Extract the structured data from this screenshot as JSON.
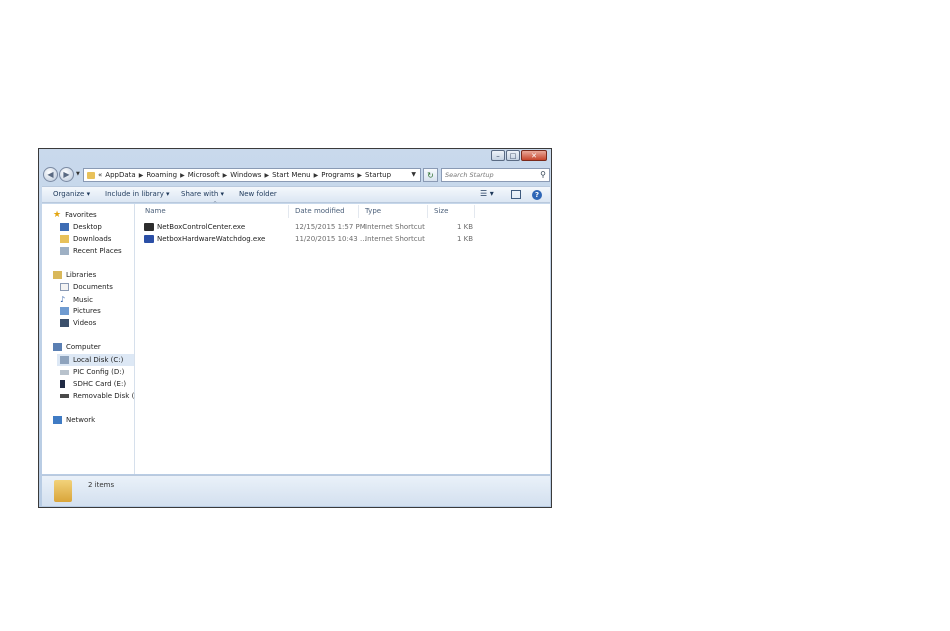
{
  "window": {
    "controls": {
      "minimize": "–",
      "maximize": "□",
      "close": "✕"
    }
  },
  "navigation": {
    "back_icon": "back-arrow-icon",
    "forward_icon": "forward-arrow-icon",
    "breadcrumb": [
      "«",
      "AppData",
      "Roaming",
      "Microsoft",
      "Windows",
      "Start Menu",
      "Programs",
      "Startup"
    ],
    "search_placeholder": "Search Startup"
  },
  "toolbar": {
    "organize": "Organize ▾",
    "include_in_library": "Include in library ▾",
    "share_with": "Share with ▾",
    "new_folder": "New folder"
  },
  "sidebar": {
    "favorites": {
      "label": "Favorites",
      "items": [
        "Desktop",
        "Downloads",
        "Recent Places"
      ]
    },
    "libraries": {
      "label": "Libraries",
      "items": [
        "Documents",
        "Music",
        "Pictures",
        "Videos"
      ]
    },
    "computer": {
      "label": "Computer",
      "items": [
        "Local Disk (C:)",
        "PIC Config (D:)",
        "SDHC Card (E:)",
        "Removable Disk (F:)"
      ]
    },
    "network": {
      "label": "Network"
    }
  },
  "file_list": {
    "columns": [
      "Name",
      "Date modified",
      "Type",
      "Size"
    ],
    "rows": [
      {
        "name": "NetBoxControlCenter.exe",
        "date": "12/15/2015 1:57 PM",
        "type": "Internet Shortcut",
        "size": "1 KB"
      },
      {
        "name": "NetboxHardwareWatchdog.exe",
        "date": "11/20/2015 10:43 ...",
        "type": "Internet Shortcut",
        "size": "1 KB"
      }
    ]
  },
  "status": {
    "item_count": "2 items"
  },
  "colors": {
    "accent": "#1e395b",
    "folder": "#e8c15a",
    "selection": "#dde8f5"
  }
}
